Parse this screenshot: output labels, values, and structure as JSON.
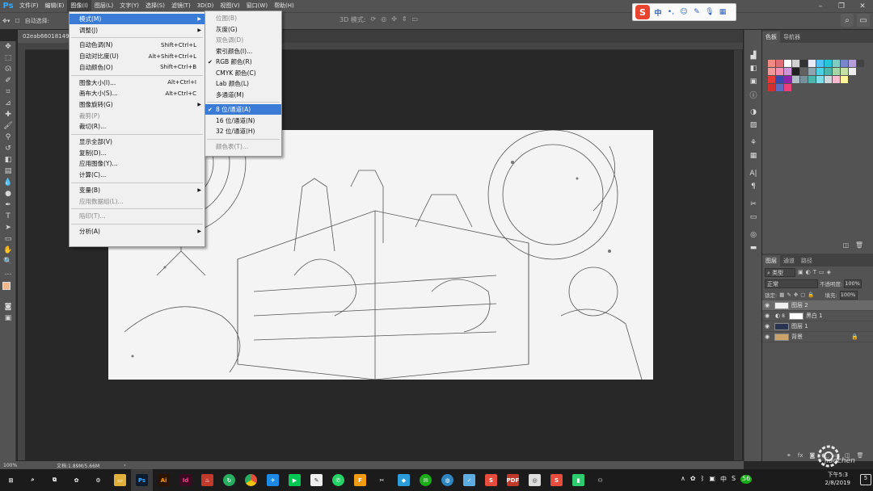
{
  "app": {
    "logo": "Ps"
  },
  "menubar": [
    "文件(F)",
    "编辑(E)",
    "图像(I)",
    "图层(L)",
    "文字(Y)",
    "选择(S)",
    "滤镜(T)",
    "3D(D)",
    "视图(V)",
    "窗口(W)",
    "帮助(H)"
  ],
  "options": {
    "auto_select": "自动选择:",
    "mode_3d": "3D 模式:"
  },
  "document": {
    "tab": "02eab660181493..."
  },
  "image_menu": {
    "items": [
      {
        "label": "模式(M)",
        "shortcut": "",
        "submenu": true,
        "disabled": false,
        "highlight": true
      },
      {
        "label": "调整(J)",
        "shortcut": "",
        "submenu": true,
        "disabled": false
      },
      {
        "label": "自动色调(N)",
        "shortcut": "Shift+Ctrl+L",
        "disabled": false
      },
      {
        "label": "自动对比度(U)",
        "shortcut": "Alt+Shift+Ctrl+L",
        "disabled": false
      },
      {
        "label": "自动颜色(O)",
        "shortcut": "Shift+Ctrl+B",
        "disabled": false
      },
      {
        "label": "图像大小(I)...",
        "shortcut": "Alt+Ctrl+I",
        "disabled": false
      },
      {
        "label": "画布大小(S)...",
        "shortcut": "Alt+Ctrl+C",
        "disabled": false
      },
      {
        "label": "图像旋转(G)",
        "shortcut": "",
        "submenu": true,
        "disabled": false
      },
      {
        "label": "裁剪(P)",
        "shortcut": "",
        "disabled": true
      },
      {
        "label": "裁切(R)...",
        "shortcut": "",
        "disabled": false
      },
      {
        "label": "显示全部(V)",
        "shortcut": "",
        "disabled": false
      },
      {
        "label": "复制(D)...",
        "shortcut": "",
        "disabled": false
      },
      {
        "label": "应用图像(Y)...",
        "shortcut": "",
        "disabled": false
      },
      {
        "label": "计算(C)...",
        "shortcut": "",
        "disabled": false
      },
      {
        "label": "变量(B)",
        "shortcut": "",
        "submenu": true,
        "disabled": false
      },
      {
        "label": "应用数据组(L)...",
        "shortcut": "",
        "disabled": true
      },
      {
        "label": "陷印(T)...",
        "shortcut": "",
        "disabled": true
      },
      {
        "label": "分析(A)",
        "shortcut": "",
        "submenu": true,
        "disabled": false
      }
    ]
  },
  "mode_menu": {
    "items": [
      {
        "label": "位图(B)",
        "disabled": true
      },
      {
        "label": "灰度(G)",
        "disabled": false
      },
      {
        "label": "双色调(D)",
        "disabled": true
      },
      {
        "label": "索引颜色(I)...",
        "disabled": false
      },
      {
        "label": "RGB 颜色(R)",
        "checked": true
      },
      {
        "label": "CMYK 颜色(C)",
        "disabled": false
      },
      {
        "label": "Lab 颜色(L)",
        "disabled": false
      },
      {
        "label": "多通道(M)",
        "disabled": false
      },
      {
        "label": "8 位/通道(A)",
        "checked": true,
        "highlight": true
      },
      {
        "label": "16 位/通道(N)",
        "disabled": false
      },
      {
        "label": "32 位/通道(H)",
        "disabled": false
      },
      {
        "label": "颜色表(T)...",
        "disabled": true
      }
    ]
  },
  "panels": {
    "top_tabs": [
      "色板",
      "导航器"
    ],
    "layer_tabs": [
      "图层",
      "通道",
      "路径"
    ],
    "filter_kind": "类型",
    "blend_mode": "正常",
    "opacity_label": "不透明度:",
    "opacity_value": "100%",
    "lock_label": "锁定:",
    "fill_label": "填充:",
    "fill_value": "100%",
    "layers": [
      {
        "name": "图层 2",
        "selected": true
      },
      {
        "name": "黑白 1",
        "selected": false,
        "adjustment": true
      },
      {
        "name": "图层 1",
        "selected": false
      },
      {
        "name": "背景",
        "selected": false,
        "locked": true
      }
    ]
  },
  "status": {
    "zoom": "100%",
    "doc": "文档:1.89M/5.66M"
  },
  "ime": {
    "lang": "中"
  },
  "taskbar": {
    "time": "下午5:3",
    "date": "2/8/2019",
    "ime": "中",
    "badge": "56",
    "notif": "5"
  },
  "watermark": {
    "text": "jiaochen"
  },
  "colors": {
    "accent": "#3a7bd5",
    "ps_blue": "#31a8ff"
  }
}
